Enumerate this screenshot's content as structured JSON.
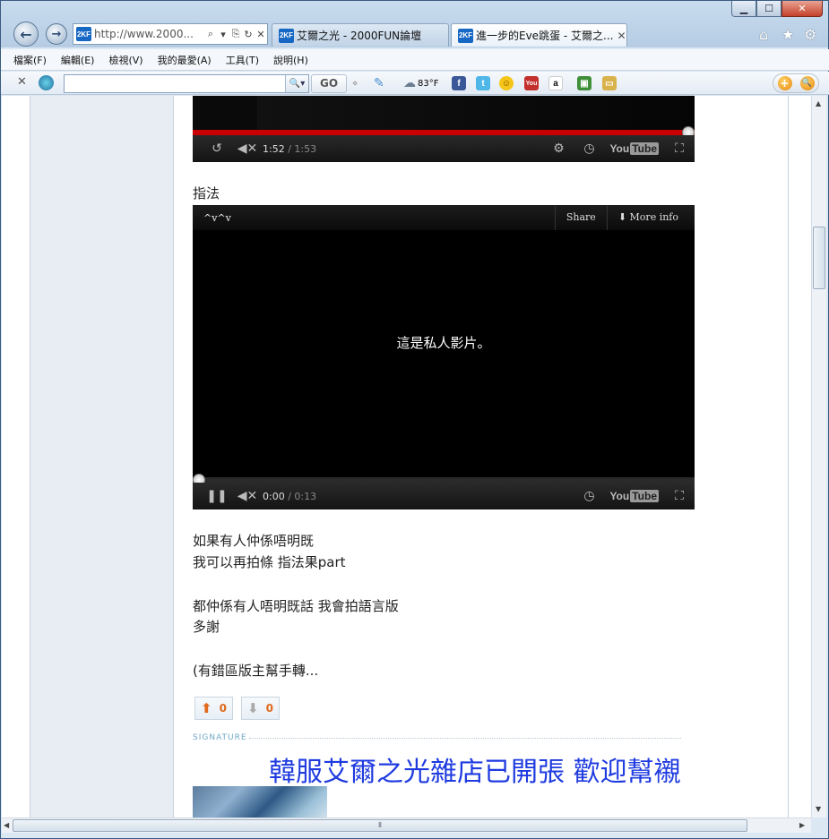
{
  "window": {
    "caption": {
      "minimize": "▁",
      "maximize": "☐",
      "close": "✕"
    }
  },
  "nav": {
    "back_icon": "←",
    "forward_icon": "→",
    "favicon_text": "2KF",
    "address_url": "http://www.2000...",
    "address_icons": [
      "⌕",
      "▾",
      "⎘",
      "↻",
      "✕"
    ]
  },
  "tabs": [
    {
      "favicon": "2KF",
      "title": "艾爾之光 - 2000FUN論壇",
      "active": false
    },
    {
      "favicon": "2KF",
      "title": "進一步的Eve跳蛋 - 艾爾之...",
      "active": true,
      "close": "✕"
    }
  ],
  "right_icons": {
    "home": "⌂",
    "favorites": "★",
    "tools": "⚙"
  },
  "menu": [
    "檔案(F)",
    "編輯(E)",
    "檢視(V)",
    "我的最愛(A)",
    "工具(T)",
    "說明(H)"
  ],
  "toolbar": {
    "close": "✕",
    "search_placeholder": "",
    "search_button": "🔍▾",
    "go_label": "GO",
    "weather": "83°F",
    "facebook": "f",
    "twitter": "t",
    "youtube": "You",
    "amazon": "a",
    "right_buttons": [
      "+",
      "🔍"
    ]
  },
  "player1": {
    "time_current": "1:52",
    "time_total": " / 1:53",
    "progress": 1.0
  },
  "section_label": "指法",
  "player2": {
    "logo": "^v^v",
    "share": "Share",
    "more_info": "More info",
    "message": "這是私人影片。",
    "time_current": "0:00",
    "time_total": " / 0:13",
    "progress": 0.0
  },
  "post": {
    "lines_a": [
      "如果有人仲係唔明既",
      "我可以再拍條 指法果part"
    ],
    "lines_b": [
      "都仲係有人唔明既話 我會拍語言版",
      "多謝"
    ],
    "note": "(有錯區版主幫手轉..."
  },
  "votes": {
    "up_count": "0",
    "down_count": "0",
    "up_icon": "⬆",
    "down_icon": "⬇"
  },
  "signature": {
    "label": "SIGNATURE",
    "title": "韓服艾爾之光雜店已開張 歡迎幫襯"
  },
  "scroll": {
    "v_up": "▲",
    "v_down": "▼",
    "h_left": "◀",
    "h_right": "▶",
    "grip": "⦀"
  }
}
